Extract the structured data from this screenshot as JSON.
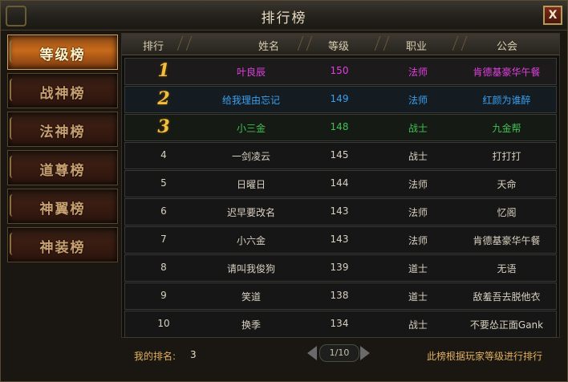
{
  "window": {
    "title": "排行榜",
    "close_label": "X"
  },
  "sidebar": {
    "tabs": [
      {
        "label": "等级榜",
        "active": true
      },
      {
        "label": "战神榜",
        "active": false
      },
      {
        "label": "法神榜",
        "active": false
      },
      {
        "label": "道尊榜",
        "active": false
      },
      {
        "label": "神翼榜",
        "active": false
      },
      {
        "label": "神装榜",
        "active": false
      }
    ]
  },
  "table": {
    "headers": [
      "排行",
      "姓名",
      "等级",
      "职业",
      "公会"
    ],
    "rows": [
      {
        "rank": "1",
        "name": "叶良辰",
        "level": "150",
        "class": "法师",
        "guild": "肯德基豪华午餐",
        "color": "#e040e0"
      },
      {
        "rank": "2",
        "name": "给我理由忘记",
        "level": "149",
        "class": "法师",
        "guild": "红颜为谁醉",
        "color": "#3aa0f0"
      },
      {
        "rank": "3",
        "name": "小三金",
        "level": "148",
        "class": "战士",
        "guild": "九金帮",
        "color": "#40c050"
      },
      {
        "rank": "4",
        "name": "一剑凌云",
        "level": "145",
        "class": "战士",
        "guild": "打打打",
        "color": "#d8d0c0"
      },
      {
        "rank": "5",
        "name": "日曜日",
        "level": "144",
        "class": "法师",
        "guild": "天命",
        "color": "#d8d0c0"
      },
      {
        "rank": "6",
        "name": "迟早要改名",
        "level": "143",
        "class": "法师",
        "guild": "忆阁",
        "color": "#d8d0c0"
      },
      {
        "rank": "7",
        "name": "小六金",
        "level": "143",
        "class": "法师",
        "guild": "肯德基豪华午餐",
        "color": "#d8d0c0"
      },
      {
        "rank": "8",
        "name": "请叫我俊狗",
        "level": "139",
        "class": "道士",
        "guild": "无语",
        "color": "#d8d0c0"
      },
      {
        "rank": "9",
        "name": "笑道",
        "level": "138",
        "class": "道士",
        "guild": "敌羞吾去脱他衣",
        "color": "#d8d0c0"
      },
      {
        "rank": "10",
        "name": "换季",
        "level": "134",
        "class": "战士",
        "guild": "不要怂正面Gank",
        "color": "#d8d0c0"
      }
    ]
  },
  "footer": {
    "my_rank_label": "我的排名:",
    "my_rank_value": "3",
    "page": "1/10",
    "note": "此榜根据玩家等级进行排行"
  }
}
